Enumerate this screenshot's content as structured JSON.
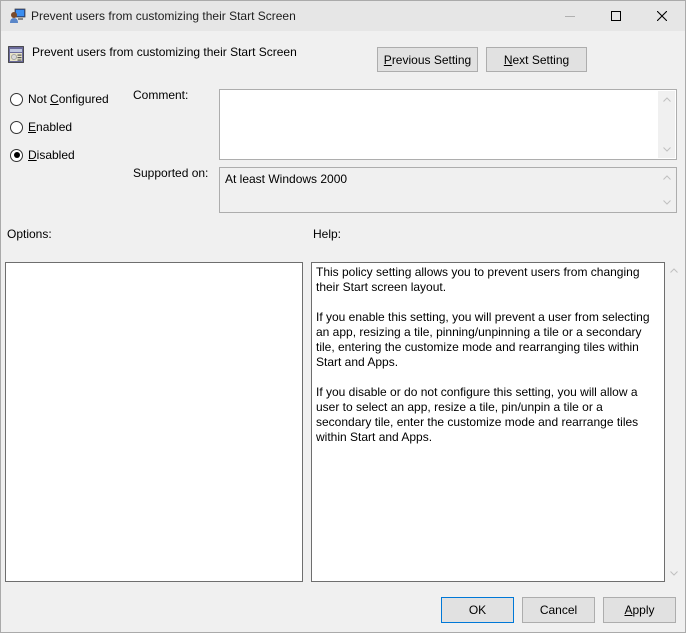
{
  "window": {
    "title": "Prevent users from customizing their Start Screen",
    "controls": {
      "minimize": "minimize",
      "maximize": "maximize",
      "close": "close"
    }
  },
  "header": {
    "title": "Prevent users from customizing their Start Screen",
    "previous_button": {
      "label_pre": "",
      "label_accel": "P",
      "label_post": "revious Setting"
    },
    "next_button": {
      "label_pre": "",
      "label_accel": "N",
      "label_post": "ext Setting"
    }
  },
  "state": {
    "options": [
      {
        "pre": "Not ",
        "accel": "C",
        "post": "onfigured",
        "checked": false
      },
      {
        "pre": "",
        "accel": "E",
        "post": "nabled",
        "checked": false
      },
      {
        "pre": "",
        "accel": "D",
        "post": "isabled",
        "checked": true
      }
    ]
  },
  "comment": {
    "label": "Comment:",
    "value": ""
  },
  "supported_on": {
    "label": "Supported on:",
    "value": "At least Windows 2000"
  },
  "options_panel": {
    "label": "Options:"
  },
  "help_panel": {
    "label": "Help:",
    "paragraphs": [
      "This policy setting allows you to prevent users from changing their Start screen layout.",
      "If you enable this setting, you will prevent a user from selecting an app, resizing a tile, pinning/unpinning a tile or a secondary tile, entering the customize mode and rearranging tiles within Start and Apps.",
      "If you disable or do not configure this setting, you will allow a user to select an app, resize a tile, pin/unpin a tile or a secondary tile, enter the customize mode and rearrange tiles within Start and Apps."
    ]
  },
  "footer": {
    "ok": "OK",
    "cancel": "Cancel",
    "apply": {
      "accel": "A",
      "post": "pply"
    }
  },
  "colors": {
    "accent": "#0078d7",
    "background": "#f0f0f0",
    "titlebar": "#e6e6e6"
  }
}
